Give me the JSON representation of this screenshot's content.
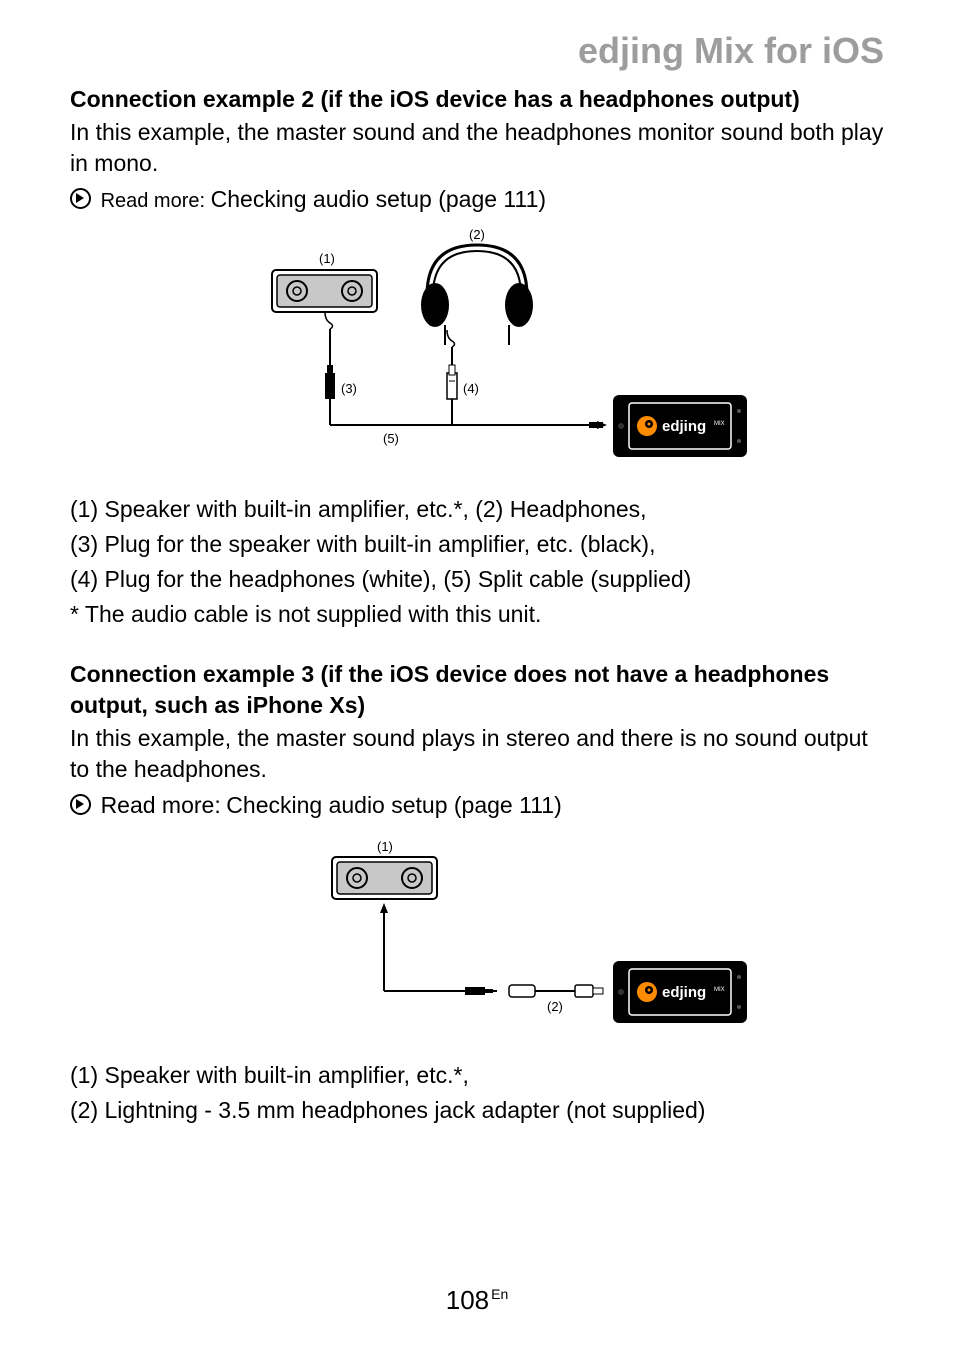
{
  "header": {
    "title": "edjing Mix for iOS"
  },
  "section1": {
    "heading": "Connection example 2 (if the iOS device has a headphones output)",
    "para": "In this example, the master sound and the headphones monitor sound both play in mono.",
    "readmore_label": "Read more:",
    "readmore_link": "Checking audio setup (page 111)",
    "figure_labels": {
      "l1": "(1)",
      "l2": "(2)",
      "l3": "(3)",
      "l4": "(4)",
      "l5": "(5)",
      "device": "edjing",
      "device_sup": "MIX"
    },
    "legend_lines": [
      "(1) Speaker with built-in amplifier, etc.*, (2) Headphones,",
      "(3) Plug for the speaker with built-in amplifier, etc. (black),",
      "(4) Plug for the headphones (white), (5) Split cable (supplied)",
      "* The audio cable is not supplied with this unit."
    ]
  },
  "section2": {
    "heading": "Connection example 3 (if the iOS device does not have a headphones output, such as iPhone Xs)",
    "para": "In this example, the master sound plays in stereo and there is no sound output to the headphones.",
    "readmore_label": "Read more:",
    "readmore_link": "Checking audio setup (page 111)",
    "figure_labels": {
      "l1": "(1)",
      "l2": "(2)",
      "device": "edjing",
      "device_sup": "MIX"
    },
    "legend_lines": [
      "(1) Speaker with built-in amplifier, etc.*,",
      "(2) Lightning - 3.5 mm headphones jack adapter (not supplied)"
    ]
  },
  "footer": {
    "page_num": "108",
    "lang": "En"
  }
}
